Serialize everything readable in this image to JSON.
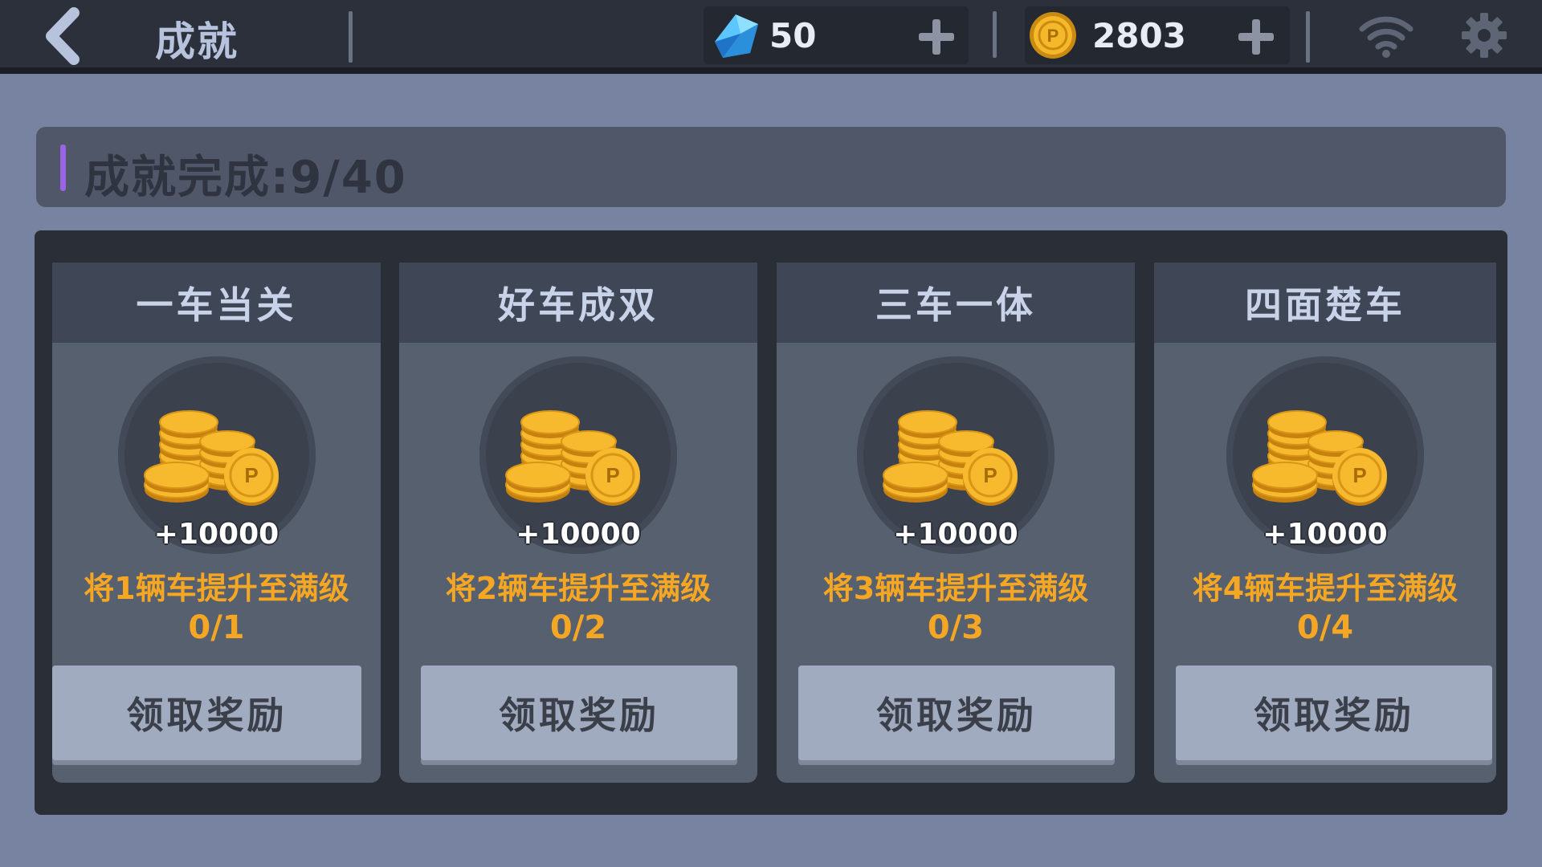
{
  "header": {
    "title": "成就",
    "gems": "50",
    "coins": "2803"
  },
  "progress": {
    "text": "成就完成:9/40"
  },
  "cards": [
    {
      "title": "一车当关",
      "reward": "+10000",
      "task": "将1辆车提升至满级",
      "progress": "0/1",
      "button": "领取奖励"
    },
    {
      "title": "好车成双",
      "reward": "+10000",
      "task": "将2辆车提升至满级",
      "progress": "0/2",
      "button": "领取奖励"
    },
    {
      "title": "三车一体",
      "reward": "+10000",
      "task": "将3辆车提升至满级",
      "progress": "0/3",
      "button": "领取奖励"
    },
    {
      "title": "四面楚车",
      "reward": "+10000",
      "task": "将4辆车提升至满级",
      "progress": "0/4",
      "button": "领取奖励"
    }
  ],
  "colors": {
    "background": "#7783a0",
    "topbar": "#2b303b",
    "task_text": "#f5a623",
    "accent_bar": "#9a64e6",
    "button": "#a1abc0"
  },
  "icons": {
    "back": "chevron-left-icon",
    "gem": "gem-icon",
    "coin": "coin-icon",
    "plus": "plus-icon",
    "wifi": "wifi-icon",
    "settings": "gear-icon",
    "reward": "coin-stack-icon"
  }
}
